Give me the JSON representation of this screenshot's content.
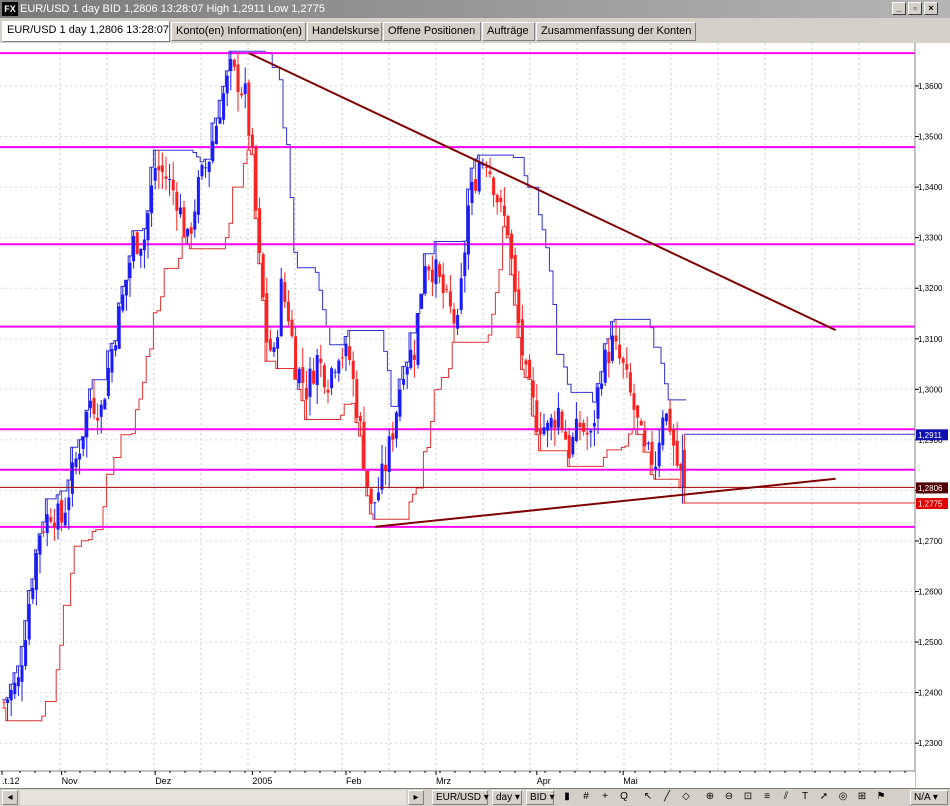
{
  "window": {
    "logo": "FX",
    "title": "EUR/USD 1 day BID 1,2806 13:28:07 High 1,2911 Low 1,2775",
    "controls": [
      "_",
      "▫",
      "×"
    ]
  },
  "tabs": [
    {
      "label": "EUR/USD 1 day 1,2806 13:28:07",
      "active": true
    },
    {
      "label": "Konto(en) Information(en)",
      "active": false
    },
    {
      "label": "Handelskurse",
      "active": false
    },
    {
      "label": "Offene Positionen",
      "active": false
    },
    {
      "label": "Aufträge",
      "active": false
    },
    {
      "label": "Zusammenfassung der Konten",
      "active": false
    }
  ],
  "toolbar": {
    "symbol": "EUR/USD",
    "period": "day",
    "price_type": "BID",
    "zoom": "N/A",
    "icons": [
      "candle-icon",
      "grid-icon",
      "crosshair-icon",
      "zoom-icon",
      "pointer-icon",
      "line-icon",
      "shape-icon",
      "zoom-in-icon",
      "zoom-out-icon",
      "fit-icon",
      "fibo-icon",
      "channel-icon",
      "text-icon",
      "arrow-icon",
      "cycle-icon",
      "period-icon",
      "marker-icon"
    ],
    "q_label": "Q",
    "arrow_down": "▾",
    "scroll_left": "◂",
    "scroll_right": "▸"
  },
  "chart_data": {
    "type": "candlestick",
    "symbol": "EUR/USD",
    "x_ticks": [
      ".t.12",
      "Nov",
      "Dez",
      "2005",
      "Feb",
      "Mrz",
      "Apr",
      "Mai"
    ],
    "y_ticks": [
      "1,2300",
      "1,2400",
      "1,2500",
      "1,2600",
      "1,2700",
      "1,2800",
      "1,2900",
      "1,3000",
      "1,3100",
      "1,3200",
      "1,3300",
      "1,3400",
      "1,3500",
      "1,3600"
    ],
    "ylim": [
      1.2245,
      1.3685
    ],
    "price_labels": {
      "high": "1,2911",
      "current": "1,2806",
      "low": "1,2775"
    },
    "high": 1.2911,
    "current": 1.2806,
    "low": 1.2775,
    "horizontal_levels": [
      1.3665,
      1.3479,
      1.3287,
      1.3124,
      1.2921,
      1.2841,
      1.2728
    ],
    "trend_lines": [
      {
        "from": {
          "day": 68,
          "price": 1.3665
        },
        "to": {
          "day": 231,
          "price": 1.3117
        }
      },
      {
        "from": {
          "day": 103,
          "price": 1.2728
        },
        "to": {
          "day": 231,
          "price": 1.2823
        }
      }
    ],
    "close_path": [
      [
        0,
        1.238
      ],
      [
        4,
        1.242
      ],
      [
        7,
        1.258
      ],
      [
        10,
        1.272
      ],
      [
        13,
        1.276
      ],
      [
        16,
        1.274
      ],
      [
        19,
        1.283
      ],
      [
        21,
        1.289
      ],
      [
        24,
        1.298
      ],
      [
        27,
        1.296
      ],
      [
        30,
        1.308
      ],
      [
        33,
        1.318
      ],
      [
        36,
        1.329
      ],
      [
        39,
        1.33
      ],
      [
        42,
        1.344
      ],
      [
        45,
        1.342
      ],
      [
        48,
        1.338
      ],
      [
        51,
        1.329
      ],
      [
        54,
        1.34
      ],
      [
        57,
        1.346
      ],
      [
        60,
        1.356
      ],
      [
        63,
        1.363
      ],
      [
        65,
        1.361
      ],
      [
        67,
        1.358
      ],
      [
        69,
        1.345
      ],
      [
        71,
        1.325
      ],
      [
        73,
        1.31
      ],
      [
        75,
        1.306
      ],
      [
        77,
        1.32
      ],
      [
        79,
        1.315
      ],
      [
        81,
        1.305
      ],
      [
        84,
        1.3
      ],
      [
        87,
        1.306
      ],
      [
        90,
        1.302
      ],
      [
        93,
        1.308
      ],
      [
        96,
        1.306
      ],
      [
        99,
        1.292
      ],
      [
        102,
        1.276
      ],
      [
        104,
        1.28
      ],
      [
        106,
        1.285
      ],
      [
        108,
        1.292
      ],
      [
        111,
        1.305
      ],
      [
        114,
        1.308
      ],
      [
        117,
        1.326
      ],
      [
        120,
        1.323
      ],
      [
        123,
        1.317
      ],
      [
        126,
        1.312
      ],
      [
        129,
        1.336
      ],
      [
        132,
        1.345
      ],
      [
        134,
        1.346
      ],
      [
        136,
        1.341
      ],
      [
        138,
        1.335
      ],
      [
        140,
        1.332
      ],
      [
        142,
        1.318
      ],
      [
        145,
        1.302
      ],
      [
        148,
        1.294
      ],
      [
        151,
        1.292
      ],
      [
        154,
        1.296
      ],
      [
        157,
        1.288
      ],
      [
        160,
        1.293
      ],
      [
        163,
        1.29
      ],
      [
        166,
        1.304
      ],
      [
        169,
        1.309
      ],
      [
        172,
        1.304
      ],
      [
        175,
        1.296
      ],
      [
        178,
        1.287
      ],
      [
        181,
        1.286
      ],
      [
        183,
        1.296
      ],
      [
        185,
        1.293
      ],
      [
        187,
        1.285
      ],
      [
        189,
        1.2806
      ]
    ]
  }
}
